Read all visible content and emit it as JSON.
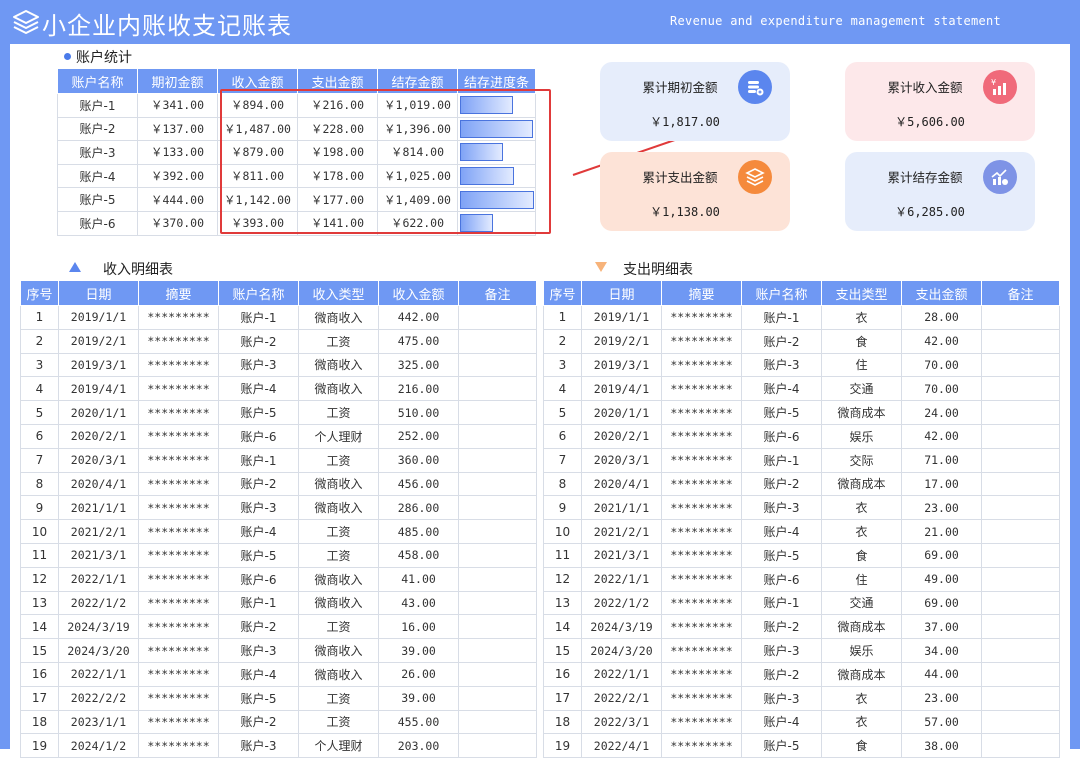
{
  "header": {
    "title": "小企业内账收支记账表",
    "subtitle_en": "Revenue and expenditure management statement"
  },
  "accounts": {
    "section_title": "账户统计",
    "columns": [
      "账户名称",
      "期初金额",
      "收入金额",
      "支出金额",
      "结存金额",
      "结存进度条"
    ],
    "rows": [
      {
        "name": "账户-1",
        "opening": "￥341.00",
        "income": "￥894.00",
        "expense": "￥216.00",
        "balance": "￥1,019.00",
        "progress": 0.72
      },
      {
        "name": "账户-2",
        "opening": "￥137.00",
        "income": "￥1,487.00",
        "expense": "￥228.00",
        "balance": "￥1,396.00",
        "progress": 0.99
      },
      {
        "name": "账户-3",
        "opening": "￥133.00",
        "income": "￥879.00",
        "expense": "￥198.00",
        "balance": "￥814.00",
        "progress": 0.58
      },
      {
        "name": "账户-4",
        "opening": "￥392.00",
        "income": "￥811.00",
        "expense": "￥178.00",
        "balance": "￥1,025.00",
        "progress": 0.73
      },
      {
        "name": "账户-5",
        "opening": "￥444.00",
        "income": "￥1,142.00",
        "expense": "￥177.00",
        "balance": "￥1,409.00",
        "progress": 1.0
      },
      {
        "name": "账户-6",
        "opening": "￥370.00",
        "income": "￥393.00",
        "expense": "￥141.00",
        "balance": "￥622.00",
        "progress": 0.44
      }
    ]
  },
  "cards": {
    "opening": {
      "title": "累计期初金额",
      "value": "￥1,817.00",
      "bg": "#e6edfb",
      "icon_color": "#5b86ee",
      "icon": "coins-icon"
    },
    "income": {
      "title": "累计收入金额",
      "value": "￥5,606.00",
      "bg": "#fde8ea",
      "icon_color": "#f06a7a",
      "icon": "yen-chart-icon"
    },
    "expense": {
      "title": "累计支出金额",
      "value": "￥1,138.00",
      "bg": "#fde3d7",
      "icon_color": "#f58a3c",
      "icon": "layers-icon"
    },
    "balance": {
      "title": "累计结存金额",
      "value": "￥6,285.00",
      "bg": "#e6edfb",
      "icon_color": "#7e93e6",
      "icon": "trend-chart-icon"
    }
  },
  "income_detail": {
    "section_title": "收入明细表",
    "columns": [
      "序号",
      "日期",
      "摘要",
      "账户名称",
      "收入类型",
      "收入金额",
      "备注"
    ],
    "rows": [
      [
        "1",
        "2019/1/1",
        "*********",
        "账户-1",
        "微商收入",
        "442.00",
        ""
      ],
      [
        "2",
        "2019/2/1",
        "*********",
        "账户-2",
        "工资",
        "475.00",
        ""
      ],
      [
        "3",
        "2019/3/1",
        "*********",
        "账户-3",
        "微商收入",
        "325.00",
        ""
      ],
      [
        "4",
        "2019/4/1",
        "*********",
        "账户-4",
        "微商收入",
        "216.00",
        ""
      ],
      [
        "5",
        "2020/1/1",
        "*********",
        "账户-5",
        "工资",
        "510.00",
        ""
      ],
      [
        "6",
        "2020/2/1",
        "*********",
        "账户-6",
        "个人理财",
        "252.00",
        ""
      ],
      [
        "7",
        "2020/3/1",
        "*********",
        "账户-1",
        "工资",
        "360.00",
        ""
      ],
      [
        "8",
        "2020/4/1",
        "*********",
        "账户-2",
        "微商收入",
        "456.00",
        ""
      ],
      [
        "9",
        "2021/1/1",
        "*********",
        "账户-3",
        "微商收入",
        "286.00",
        ""
      ],
      [
        "10",
        "2021/2/1",
        "*********",
        "账户-4",
        "工资",
        "485.00",
        ""
      ],
      [
        "11",
        "2021/3/1",
        "*********",
        "账户-5",
        "工资",
        "458.00",
        ""
      ],
      [
        "12",
        "2022/1/1",
        "*********",
        "账户-6",
        "微商收入",
        "41.00",
        ""
      ],
      [
        "13",
        "2022/1/2",
        "*********",
        "账户-1",
        "微商收入",
        "43.00",
        ""
      ],
      [
        "14",
        "2024/3/19",
        "*********",
        "账户-2",
        "工资",
        "16.00",
        ""
      ],
      [
        "15",
        "2024/3/20",
        "*********",
        "账户-3",
        "微商收入",
        "39.00",
        ""
      ],
      [
        "16",
        "2022/1/1",
        "*********",
        "账户-4",
        "微商收入",
        "26.00",
        ""
      ],
      [
        "17",
        "2022/2/2",
        "*********",
        "账户-5",
        "工资",
        "39.00",
        ""
      ],
      [
        "18",
        "2023/1/1",
        "*********",
        "账户-2",
        "工资",
        "455.00",
        ""
      ],
      [
        "19",
        "2024/1/2",
        "*********",
        "账户-3",
        "个人理财",
        "203.00",
        ""
      ]
    ]
  },
  "expense_detail": {
    "section_title": "支出明细表",
    "columns": [
      "序号",
      "日期",
      "摘要",
      "账户名称",
      "支出类型",
      "支出金额",
      "备注"
    ],
    "rows": [
      [
        "1",
        "2019/1/1",
        "*********",
        "账户-1",
        "衣",
        "28.00",
        ""
      ],
      [
        "2",
        "2019/2/1",
        "*********",
        "账户-2",
        "食",
        "42.00",
        ""
      ],
      [
        "3",
        "2019/3/1",
        "*********",
        "账户-3",
        "住",
        "70.00",
        ""
      ],
      [
        "4",
        "2019/4/1",
        "*********",
        "账户-4",
        "交通",
        "70.00",
        ""
      ],
      [
        "5",
        "2020/1/1",
        "*********",
        "账户-5",
        "微商成本",
        "24.00",
        ""
      ],
      [
        "6",
        "2020/2/1",
        "*********",
        "账户-6",
        "娱乐",
        "42.00",
        ""
      ],
      [
        "7",
        "2020/3/1",
        "*********",
        "账户-1",
        "交际",
        "71.00",
        ""
      ],
      [
        "8",
        "2020/4/1",
        "*********",
        "账户-2",
        "微商成本",
        "17.00",
        ""
      ],
      [
        "9",
        "2021/1/1",
        "*********",
        "账户-3",
        "衣",
        "23.00",
        ""
      ],
      [
        "10",
        "2021/2/1",
        "*********",
        "账户-4",
        "衣",
        "21.00",
        ""
      ],
      [
        "11",
        "2021/3/1",
        "*********",
        "账户-5",
        "食",
        "69.00",
        ""
      ],
      [
        "12",
        "2022/1/1",
        "*********",
        "账户-6",
        "住",
        "49.00",
        ""
      ],
      [
        "13",
        "2022/1/2",
        "*********",
        "账户-1",
        "交通",
        "69.00",
        ""
      ],
      [
        "14",
        "2024/3/19",
        "*********",
        "账户-2",
        "微商成本",
        "37.00",
        ""
      ],
      [
        "15",
        "2024/3/20",
        "*********",
        "账户-3",
        "娱乐",
        "34.00",
        ""
      ],
      [
        "16",
        "2022/1/1",
        "*********",
        "账户-2",
        "微商成本",
        "44.00",
        ""
      ],
      [
        "17",
        "2022/2/1",
        "*********",
        "账户-3",
        "衣",
        "23.00",
        ""
      ],
      [
        "18",
        "2022/3/1",
        "*********",
        "账户-4",
        "衣",
        "57.00",
        ""
      ],
      [
        "19",
        "2022/4/1",
        "*********",
        "账户-5",
        "食",
        "38.00",
        ""
      ]
    ]
  }
}
